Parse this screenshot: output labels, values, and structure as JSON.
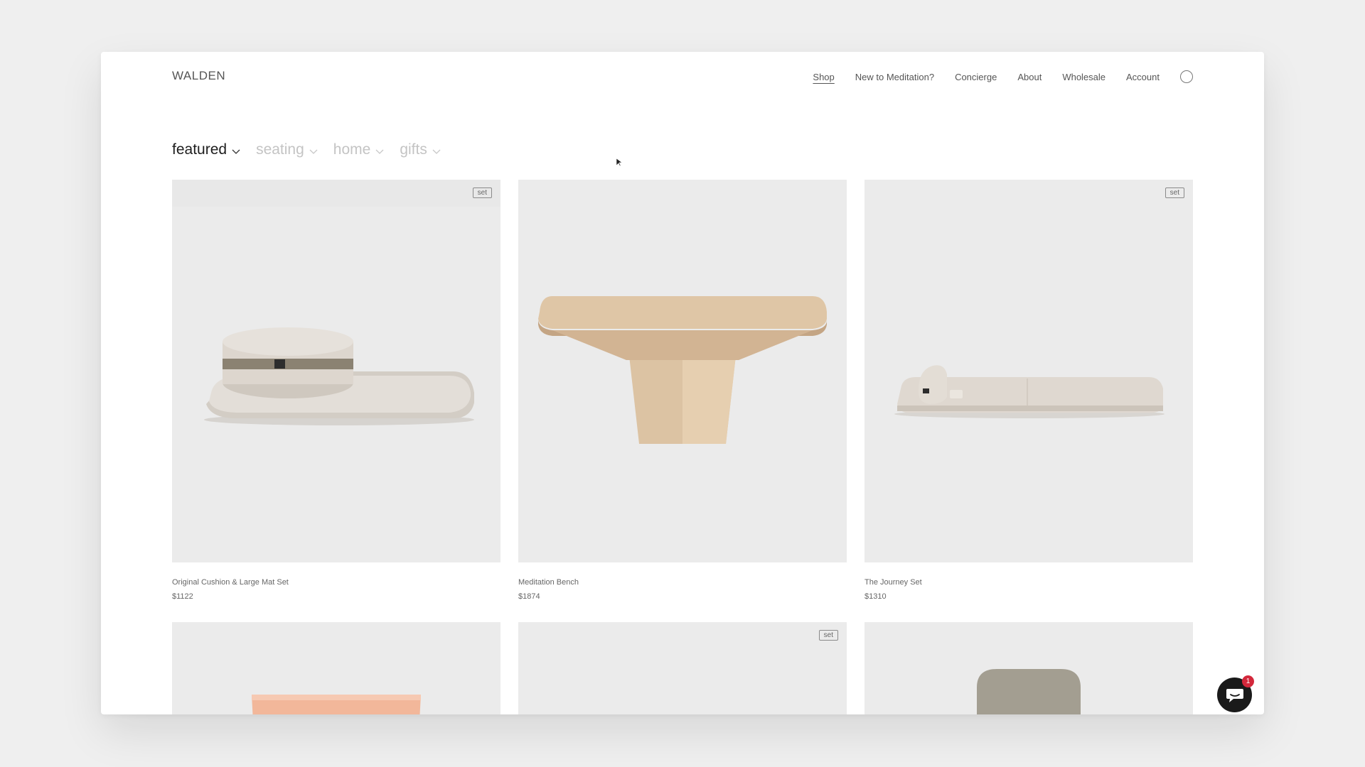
{
  "brand": {
    "logo": "WALDEN"
  },
  "nav": {
    "items": [
      {
        "label": "Shop",
        "active": true
      },
      {
        "label": "New to Meditation?",
        "active": false
      },
      {
        "label": "Concierge",
        "active": false
      },
      {
        "label": "About",
        "active": false
      },
      {
        "label": "Wholesale",
        "active": false
      },
      {
        "label": "Account",
        "active": false
      }
    ],
    "cart_icon": "circle-icon"
  },
  "filters": [
    {
      "label": "featured",
      "active": true
    },
    {
      "label": "seating",
      "active": false
    },
    {
      "label": "home",
      "active": false
    },
    {
      "label": "gifts",
      "active": false
    }
  ],
  "products": [
    {
      "name": "Original Cushion & Large Mat Set",
      "price": "$1122",
      "badge": "set"
    },
    {
      "name": "Meditation Bench",
      "price": "$1874",
      "badge": ""
    },
    {
      "name": "The Journey Set",
      "price": "$1310",
      "badge": "set"
    },
    {
      "name": "",
      "price": "",
      "badge": ""
    },
    {
      "name": "",
      "price": "",
      "badge": "set"
    },
    {
      "name": "",
      "price": "",
      "badge": ""
    }
  ],
  "chat": {
    "icon": "chat-bubble-icon",
    "unread_count": "1",
    "badge_color": "#d3283b"
  }
}
